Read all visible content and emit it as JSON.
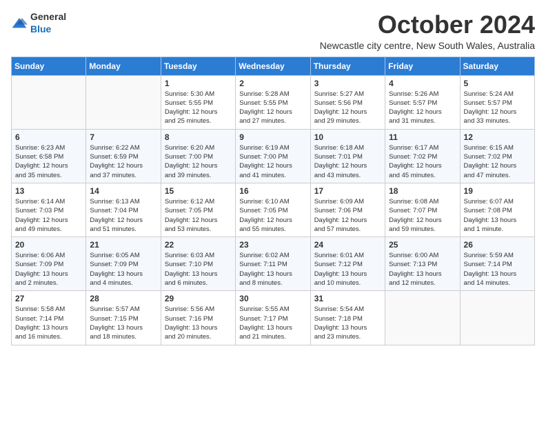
{
  "header": {
    "logo_general": "General",
    "logo_blue": "Blue",
    "month_title": "October 2024",
    "subtitle": "Newcastle city centre, New South Wales, Australia"
  },
  "days_of_week": [
    "Sunday",
    "Monday",
    "Tuesday",
    "Wednesday",
    "Thursday",
    "Friday",
    "Saturday"
  ],
  "weeks": [
    [
      {
        "day": "",
        "info": ""
      },
      {
        "day": "",
        "info": ""
      },
      {
        "day": "1",
        "info": "Sunrise: 5:30 AM\nSunset: 5:55 PM\nDaylight: 12 hours\nand 25 minutes."
      },
      {
        "day": "2",
        "info": "Sunrise: 5:28 AM\nSunset: 5:55 PM\nDaylight: 12 hours\nand 27 minutes."
      },
      {
        "day": "3",
        "info": "Sunrise: 5:27 AM\nSunset: 5:56 PM\nDaylight: 12 hours\nand 29 minutes."
      },
      {
        "day": "4",
        "info": "Sunrise: 5:26 AM\nSunset: 5:57 PM\nDaylight: 12 hours\nand 31 minutes."
      },
      {
        "day": "5",
        "info": "Sunrise: 5:24 AM\nSunset: 5:57 PM\nDaylight: 12 hours\nand 33 minutes."
      }
    ],
    [
      {
        "day": "6",
        "info": "Sunrise: 6:23 AM\nSunset: 6:58 PM\nDaylight: 12 hours\nand 35 minutes."
      },
      {
        "day": "7",
        "info": "Sunrise: 6:22 AM\nSunset: 6:59 PM\nDaylight: 12 hours\nand 37 minutes."
      },
      {
        "day": "8",
        "info": "Sunrise: 6:20 AM\nSunset: 7:00 PM\nDaylight: 12 hours\nand 39 minutes."
      },
      {
        "day": "9",
        "info": "Sunrise: 6:19 AM\nSunset: 7:00 PM\nDaylight: 12 hours\nand 41 minutes."
      },
      {
        "day": "10",
        "info": "Sunrise: 6:18 AM\nSunset: 7:01 PM\nDaylight: 12 hours\nand 43 minutes."
      },
      {
        "day": "11",
        "info": "Sunrise: 6:17 AM\nSunset: 7:02 PM\nDaylight: 12 hours\nand 45 minutes."
      },
      {
        "day": "12",
        "info": "Sunrise: 6:15 AM\nSunset: 7:02 PM\nDaylight: 12 hours\nand 47 minutes."
      }
    ],
    [
      {
        "day": "13",
        "info": "Sunrise: 6:14 AM\nSunset: 7:03 PM\nDaylight: 12 hours\nand 49 minutes."
      },
      {
        "day": "14",
        "info": "Sunrise: 6:13 AM\nSunset: 7:04 PM\nDaylight: 12 hours\nand 51 minutes."
      },
      {
        "day": "15",
        "info": "Sunrise: 6:12 AM\nSunset: 7:05 PM\nDaylight: 12 hours\nand 53 minutes."
      },
      {
        "day": "16",
        "info": "Sunrise: 6:10 AM\nSunset: 7:05 PM\nDaylight: 12 hours\nand 55 minutes."
      },
      {
        "day": "17",
        "info": "Sunrise: 6:09 AM\nSunset: 7:06 PM\nDaylight: 12 hours\nand 57 minutes."
      },
      {
        "day": "18",
        "info": "Sunrise: 6:08 AM\nSunset: 7:07 PM\nDaylight: 12 hours\nand 59 minutes."
      },
      {
        "day": "19",
        "info": "Sunrise: 6:07 AM\nSunset: 7:08 PM\nDaylight: 13 hours\nand 1 minute."
      }
    ],
    [
      {
        "day": "20",
        "info": "Sunrise: 6:06 AM\nSunset: 7:09 PM\nDaylight: 13 hours\nand 2 minutes."
      },
      {
        "day": "21",
        "info": "Sunrise: 6:05 AM\nSunset: 7:09 PM\nDaylight: 13 hours\nand 4 minutes."
      },
      {
        "day": "22",
        "info": "Sunrise: 6:03 AM\nSunset: 7:10 PM\nDaylight: 13 hours\nand 6 minutes."
      },
      {
        "day": "23",
        "info": "Sunrise: 6:02 AM\nSunset: 7:11 PM\nDaylight: 13 hours\nand 8 minutes."
      },
      {
        "day": "24",
        "info": "Sunrise: 6:01 AM\nSunset: 7:12 PM\nDaylight: 13 hours\nand 10 minutes."
      },
      {
        "day": "25",
        "info": "Sunrise: 6:00 AM\nSunset: 7:13 PM\nDaylight: 13 hours\nand 12 minutes."
      },
      {
        "day": "26",
        "info": "Sunrise: 5:59 AM\nSunset: 7:14 PM\nDaylight: 13 hours\nand 14 minutes."
      }
    ],
    [
      {
        "day": "27",
        "info": "Sunrise: 5:58 AM\nSunset: 7:14 PM\nDaylight: 13 hours\nand 16 minutes."
      },
      {
        "day": "28",
        "info": "Sunrise: 5:57 AM\nSunset: 7:15 PM\nDaylight: 13 hours\nand 18 minutes."
      },
      {
        "day": "29",
        "info": "Sunrise: 5:56 AM\nSunset: 7:16 PM\nDaylight: 13 hours\nand 20 minutes."
      },
      {
        "day": "30",
        "info": "Sunrise: 5:55 AM\nSunset: 7:17 PM\nDaylight: 13 hours\nand 21 minutes."
      },
      {
        "day": "31",
        "info": "Sunrise: 5:54 AM\nSunset: 7:18 PM\nDaylight: 13 hours\nand 23 minutes."
      },
      {
        "day": "",
        "info": ""
      },
      {
        "day": "",
        "info": ""
      }
    ]
  ]
}
